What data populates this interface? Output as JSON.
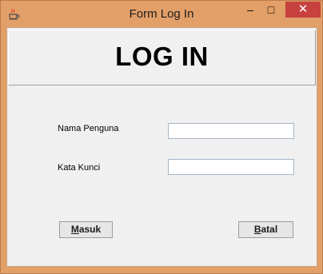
{
  "window": {
    "title": "Form Log In",
    "controls": {
      "minimize": "–",
      "maximize": "□",
      "close": "✕"
    },
    "accent_color": "#e39f68",
    "close_color": "#c7413f"
  },
  "header": {
    "heading": "LOG IN"
  },
  "form": {
    "username_label": "Nama Penguna",
    "username_value": "",
    "password_label": "Kata Kunci",
    "password_value": ""
  },
  "buttons": {
    "login": {
      "mnemonic": "M",
      "rest": "asuk"
    },
    "cancel": {
      "mnemonic": "B",
      "rest": "atal"
    }
  },
  "icons": {
    "app": "java-coffee-icon"
  }
}
